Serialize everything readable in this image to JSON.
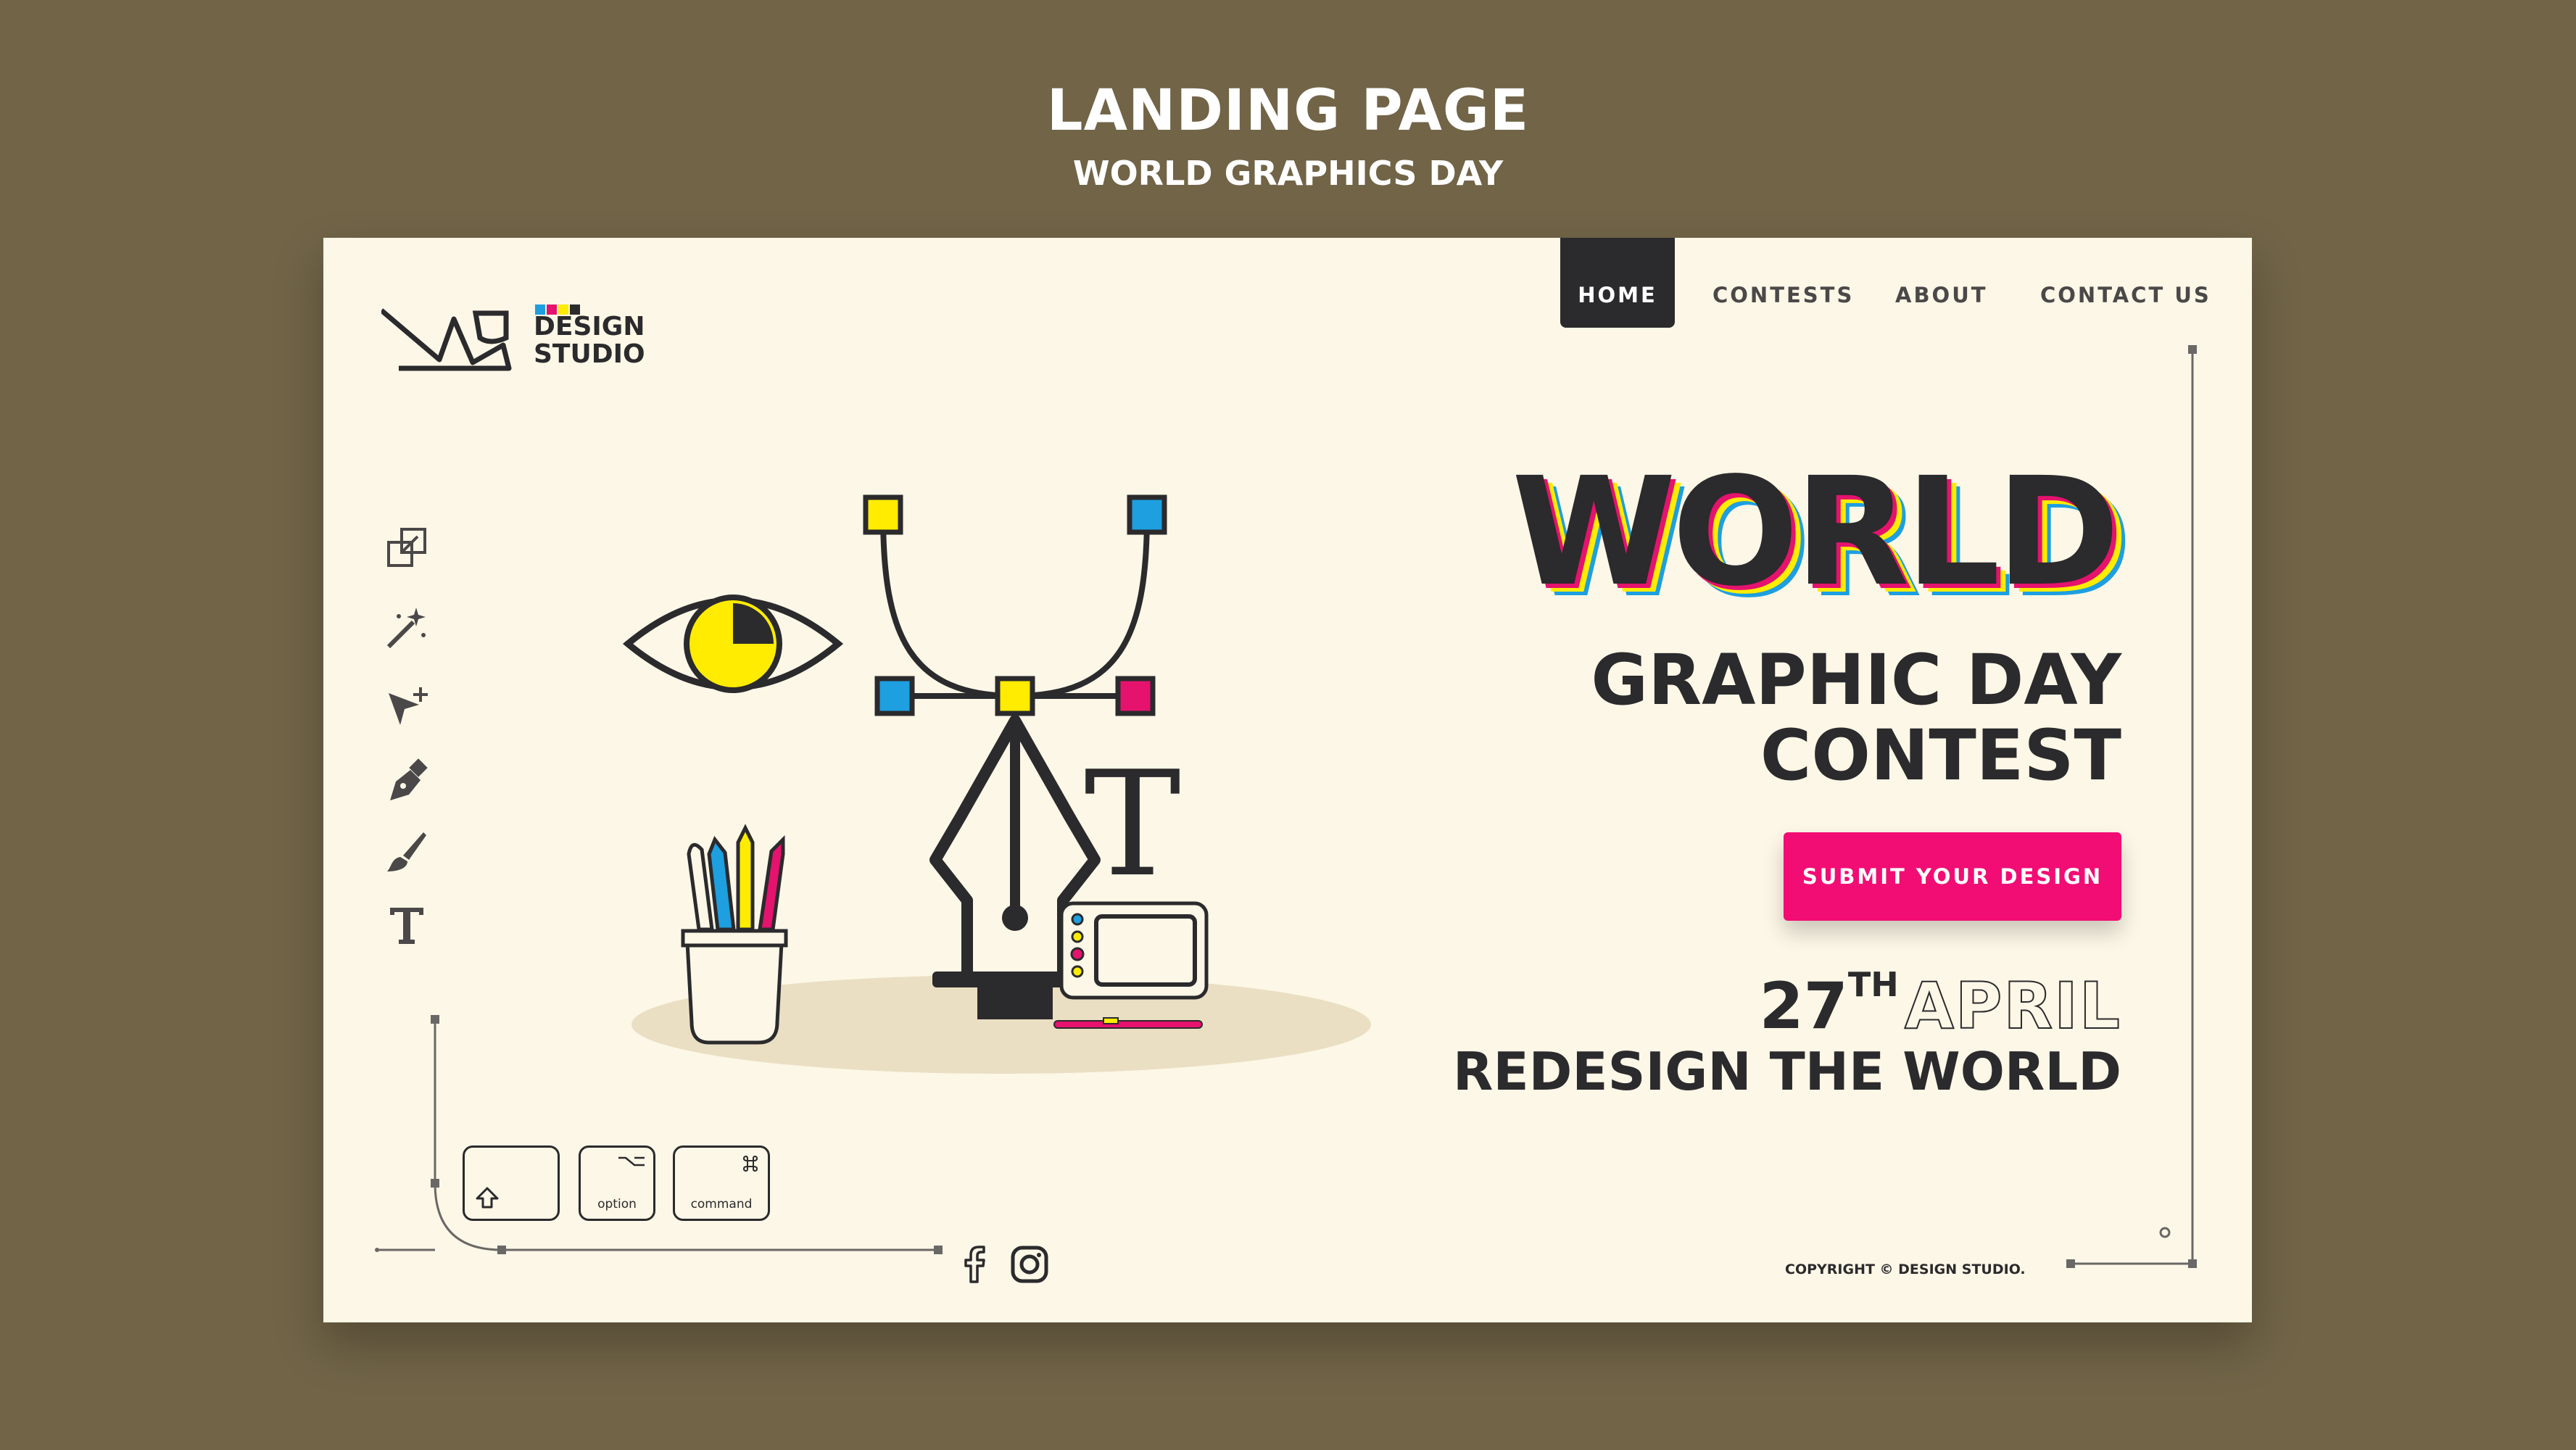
{
  "page": {
    "title": "LANDING PAGE",
    "subtitle": "WORLD GRAPHICS DAY"
  },
  "logo": {
    "line1": "DESIGN",
    "line2": "STUDIO"
  },
  "nav": {
    "home": "HOME",
    "contests": "CONTESTS",
    "about": "ABOUT",
    "contact": "CONTACT US"
  },
  "toolbar": {
    "tools": [
      "resize-icon",
      "magic-wand-icon",
      "select-arrow-icon",
      "pen-icon",
      "brush-icon",
      "text-icon"
    ]
  },
  "hero": {
    "world": "WORLD",
    "line2": "GRAPHIC DAY",
    "line3": "CONTEST",
    "cta": "SUBMIT YOUR DESIGN",
    "date_day": "27",
    "date_suffix": "TH",
    "date_month": "APRIL",
    "tagline": "REDESIGN THE WORLD"
  },
  "illustration": {
    "text_glyph": "T"
  },
  "keys": {
    "shift_label": "",
    "option_label": "option",
    "command_label": "command"
  },
  "footer": {
    "copyright": "COPYRIGHT © DESIGN STUDIO.",
    "social": [
      "facebook-icon",
      "instagram-icon"
    ]
  },
  "colors": {
    "background": "#716447",
    "card": "#fdf7e7",
    "dark": "#2b2a2c",
    "accent_pink": "#f20d74",
    "accent_yellow": "#ffec00",
    "accent_cyan": "#1d9fe0",
    "accent_magenta": "#e5126e"
  }
}
